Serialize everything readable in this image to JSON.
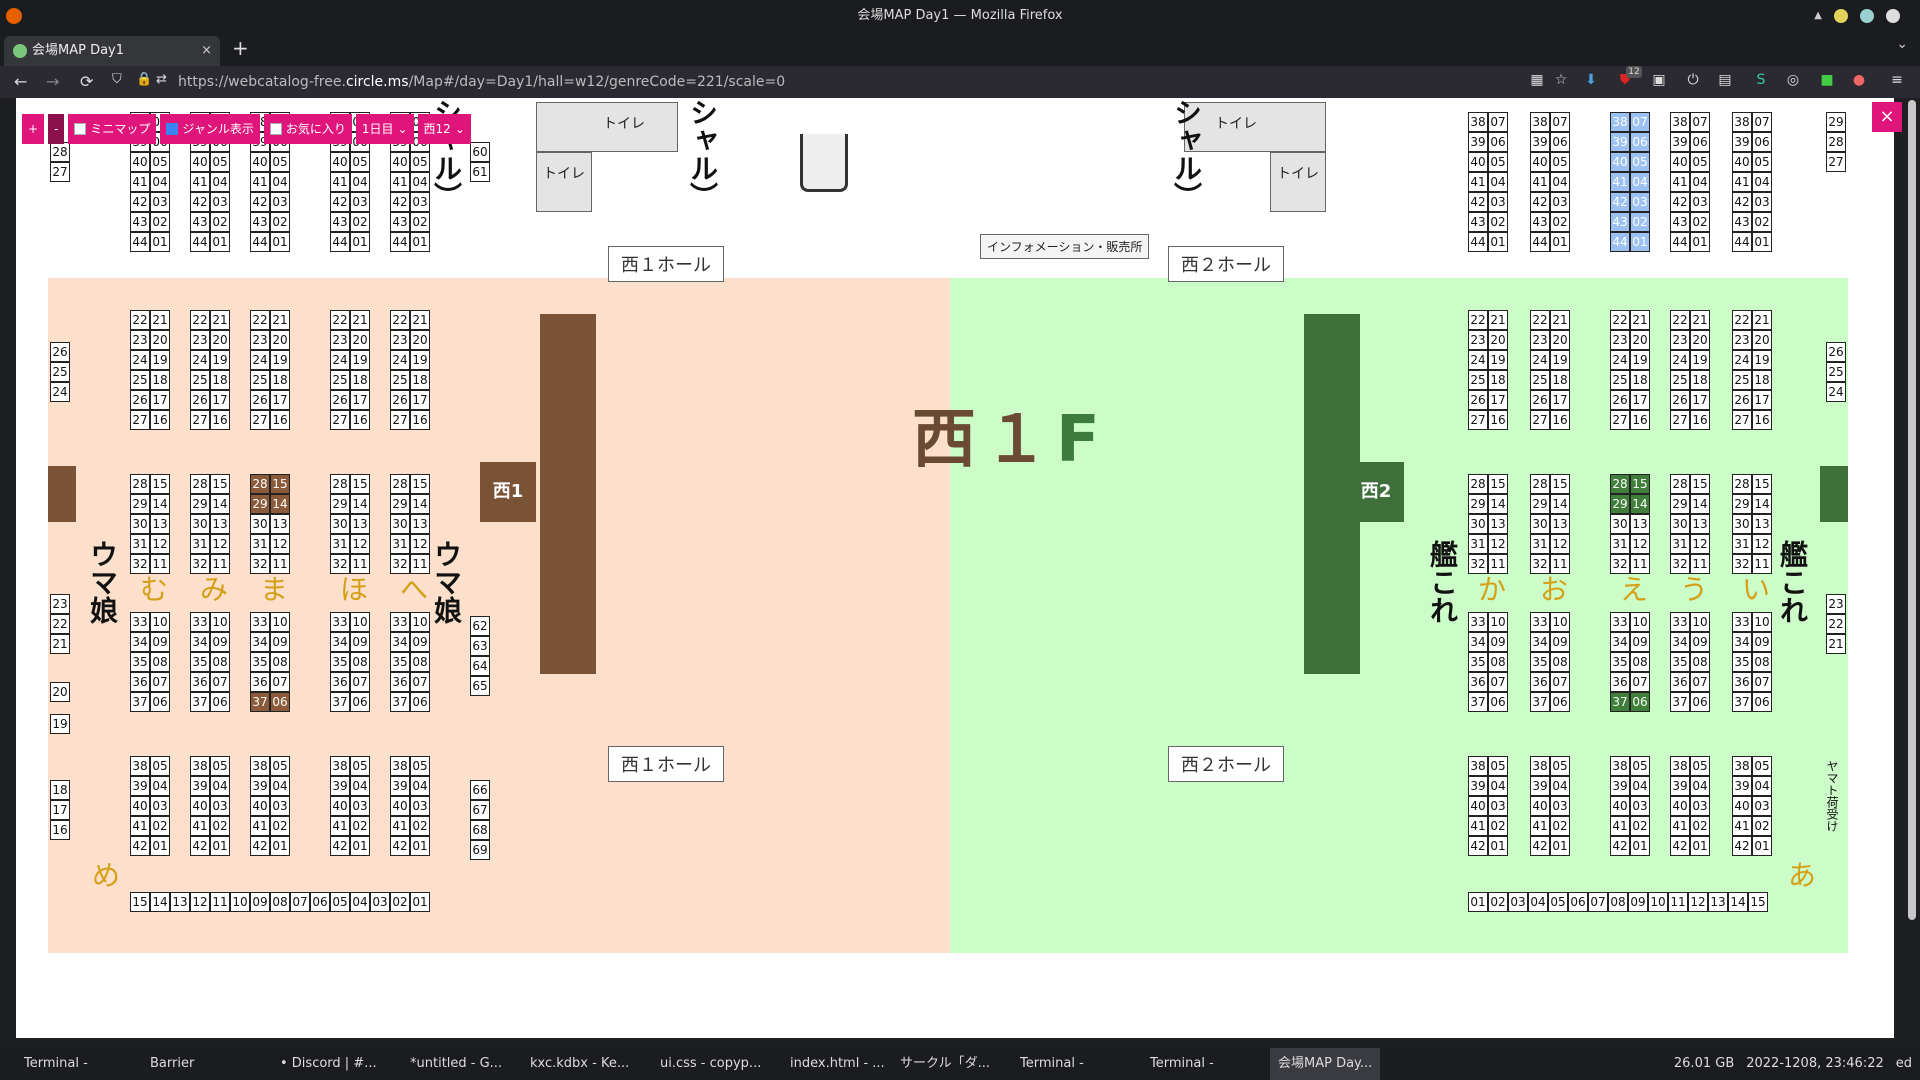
{
  "window": {
    "title": "会場MAP Day1 — Mozilla Firefox"
  },
  "tab": {
    "title": "会場MAP Day1",
    "close": "×",
    "new": "+",
    "menu": "⌄"
  },
  "nav": {
    "back": "←",
    "forward": "→",
    "reload": "⟳",
    "url_prefix": "https://webcatalog-free.",
    "url_domain": "circle.ms",
    "url_suffix": "/Map#/day=Day1/hall=w12/genreCode=221/scale=0"
  },
  "extensions": {
    "badge_count": "12"
  },
  "toolbar": {
    "zoom_in": "+",
    "zoom_out": "-",
    "minimap": "ミニマップ",
    "genre_display": "ジャンル表示",
    "favorites": "お気に入り",
    "day": "1日目",
    "hall": "西12"
  },
  "modal": {
    "close": "×"
  },
  "map": {
    "floor_title_left": "西１",
    "floor_title_right": "F",
    "hall_w1": "西１ホール",
    "hall_w2": "西２ホール",
    "hall_w1_short": "西1",
    "hall_w2_short": "西2",
    "toilet": "トイレ",
    "info_booth": "インフォメーション・販売所",
    "vertical_labels": [
      "ウマ娘",
      "ウマ娘",
      "艦これ",
      "艦これ",
      "シャル）",
      "シャル）",
      "シャル）"
    ],
    "kana_left": [
      "む",
      "み",
      "ま",
      "ほ",
      "へ",
      "め"
    ],
    "kana_right": [
      "か",
      "お",
      "え",
      "う",
      "い",
      "あ"
    ],
    "yamato": "ヤマト荷受け",
    "cells_top": [
      "38",
      "07",
      "39",
      "06",
      "40",
      "05",
      "41",
      "04",
      "42",
      "03",
      "43",
      "02",
      "44",
      "01"
    ],
    "cells_upper": [
      "22",
      "21",
      "23",
      "20",
      "24",
      "19",
      "25",
      "18",
      "26",
      "17",
      "27",
      "16"
    ],
    "cells_mid": [
      "28",
      "15",
      "29",
      "14",
      "30",
      "13",
      "31",
      "12",
      "32",
      "11"
    ],
    "cells_lower": [
      "33",
      "10",
      "34",
      "09",
      "35",
      "08",
      "36",
      "07",
      "37",
      "06"
    ],
    "cells_bottom": [
      "38",
      "05",
      "39",
      "04",
      "40",
      "03",
      "41",
      "02",
      "42",
      "01"
    ],
    "row_left": [
      "15",
      "14",
      "13",
      "12",
      "11",
      "10",
      "09",
      "08",
      "07",
      "06",
      "05",
      "04",
      "03",
      "02",
      "01"
    ],
    "row_right": [
      "01",
      "02",
      "03",
      "04",
      "05",
      "06",
      "07",
      "08",
      "09",
      "10",
      "11",
      "12",
      "13",
      "14",
      "15"
    ],
    "side_left": [
      "28",
      "27",
      "26",
      "25",
      "24",
      "23",
      "22",
      "21",
      "20",
      "19",
      "18",
      "17",
      "16"
    ],
    "side_mid": [
      "60",
      "61",
      "62",
      "63",
      "64",
      "65",
      "66",
      "67",
      "68",
      "69"
    ],
    "side_right": [
      "29",
      "28",
      "27",
      "26",
      "25",
      "24",
      "23",
      "22",
      "21"
    ]
  },
  "taskbar": {
    "items": [
      "Terminal -",
      "Barrier",
      "• Discord | #...",
      "*untitled - G...",
      "kxc.kdbx - Ke...",
      "ui.css - copyp...",
      "index.html - ...",
      "サークル「ダ...",
      "Terminal -",
      "Terminal -",
      "会場MAP Day..."
    ],
    "disk": "26.01 GB",
    "clock": "2022-1208, 23:46:22",
    "user": "ed"
  }
}
